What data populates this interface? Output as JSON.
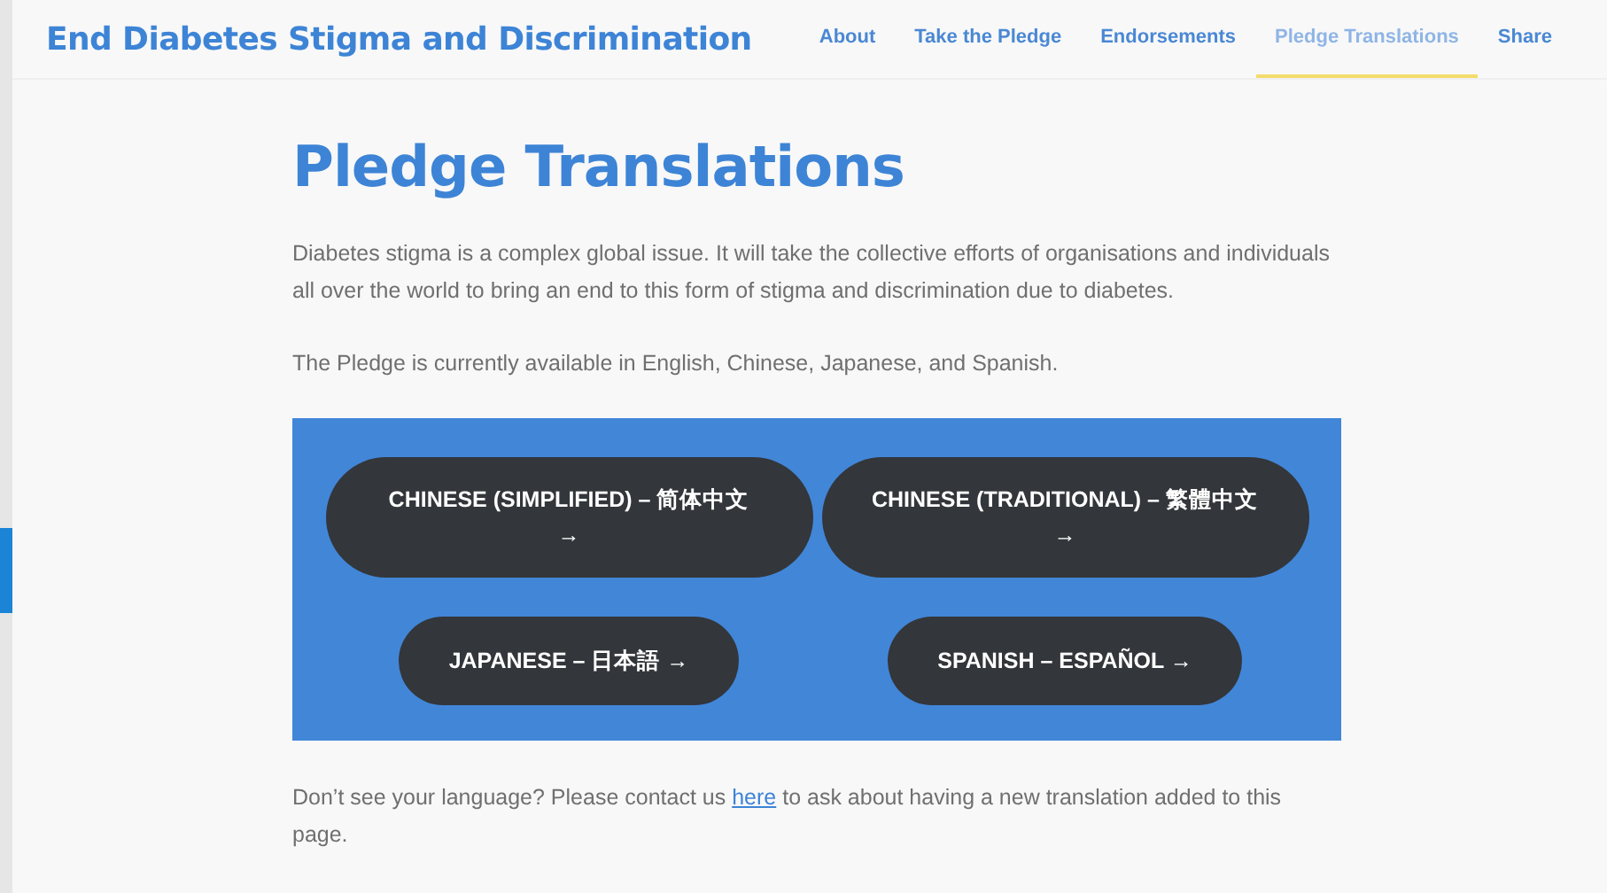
{
  "site_title": "End Diabetes Stigma and Discrimination",
  "nav": [
    {
      "label": "About",
      "selected": false
    },
    {
      "label": "Take the Pledge",
      "selected": false
    },
    {
      "label": "Endorsements",
      "selected": false
    },
    {
      "label": "Pledge Translations",
      "selected": true
    },
    {
      "label": "Share",
      "selected": false
    }
  ],
  "heading": "Pledge Translations",
  "paragraphs": [
    "Diabetes stigma is a complex global issue. It will take the collective efforts of organisations and individuals all over the world to bring an end to this form of stigma and discrimination due to diabetes.",
    "The Pledge is currently available in English, Chinese, Japanese, and Spanish."
  ],
  "language_buttons": [
    "CHINESE (SIMPLIFIED) – 简体中文 →",
    "CHINESE (TRADITIONAL) – 繁體中文 →",
    "JAPANESE – 日本語 →",
    "SPANISH – ESPAÑOL →"
  ],
  "contact": {
    "before": "Don’t see your language? Please contact us",
    "link": "here",
    "after": "to ask about having a new translation added to this page."
  }
}
